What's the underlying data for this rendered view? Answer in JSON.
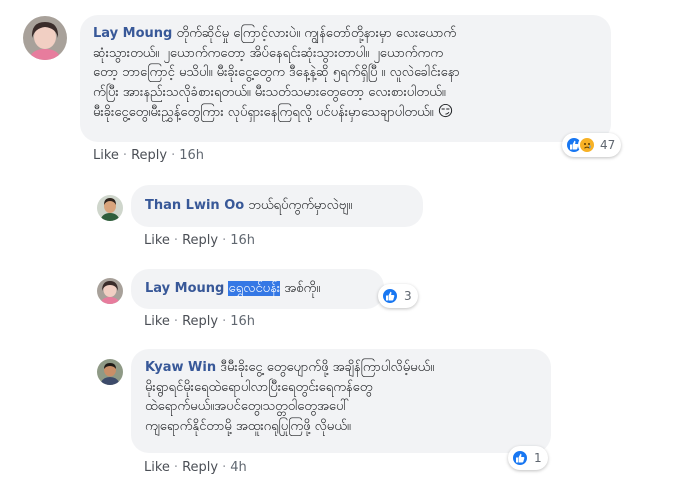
{
  "comments": [
    {
      "author": "Lay Moung",
      "text_lines": [
        "တိုက်ဆိုင်မှု ကြောင့်လားပဲ။ ကျွန်တော်တို့နားမှာ လေးယောက်",
        "ဆုံးသွားတယ်။ ၂ယောက်ကတော့ အိပ်နေရင်းဆုံးသွားတာပါ။ ၂ယောက်ကက",
        "တော့ ဘာကြောင့် မသိပါ။ မီးခိုးငွေ့တွေက ဒီနေ့နဲ့ဆို ၅ရက်ရှိပြီ ။ လူလဲခေါင်းနော",
        "က်ပြီး အားနည်းသလိုခံစားရတယ်။ မီးသတ်သမားတွေတော့ လေးစားပါတယ်။",
        "မီးခိုးငွေ့တွေ၊မီးညွှန့်တွေကြား လုပ်ရှားနေကြရလို့ ပင်ပန်းမှာသေချာပါတယ်။"
      ],
      "emoji": "😏",
      "actions": {
        "like": "Like",
        "reply": "Reply",
        "time": "16h"
      },
      "reaction_count": "47"
    },
    {
      "author": "Than Lwin Oo",
      "text": "ဘယ်ရပ်ကွက်မှာလဲဗျ။",
      "actions": {
        "like": "Like",
        "reply": "Reply",
        "time": "16h"
      }
    },
    {
      "author": "Lay Moung",
      "mention": "ရွှေလင်ပန်း",
      "text": " အစ်ကို။",
      "actions": {
        "like": "Like",
        "reply": "Reply",
        "time": "16h"
      },
      "reaction_count": "3"
    },
    {
      "author": "Kyaw Win",
      "text_lines": [
        "ဒီမီးခိုးငွေ့ တွေပျောက်ဖို့ အချိန်ကြာပါလိမ့်မယ်။",
        "မိုးရွာရင်မိုးရေထဲရောပါလာပြီးရေတွင်းရေကန်တွေ",
        "ထဲရောက်မယ်။အပင်တွေ၊သတ္တဝါတွေအပေါ်",
        "ကျရောက်နိုင်တာမို့ အထူးဂရုပြုကြဖို့ လိုမယ်။"
      ],
      "actions": {
        "like": "Like",
        "reply": "Reply",
        "time": "4h"
      },
      "reaction_count": "1"
    }
  ],
  "colors": {
    "bubble": "#f2f3f5",
    "name": "#385898",
    "like_blue": "#1877f2",
    "highlight": "#3578e5"
  },
  "icons": {
    "like": "thumbs-up-icon",
    "sad": "sad-face-icon"
  }
}
